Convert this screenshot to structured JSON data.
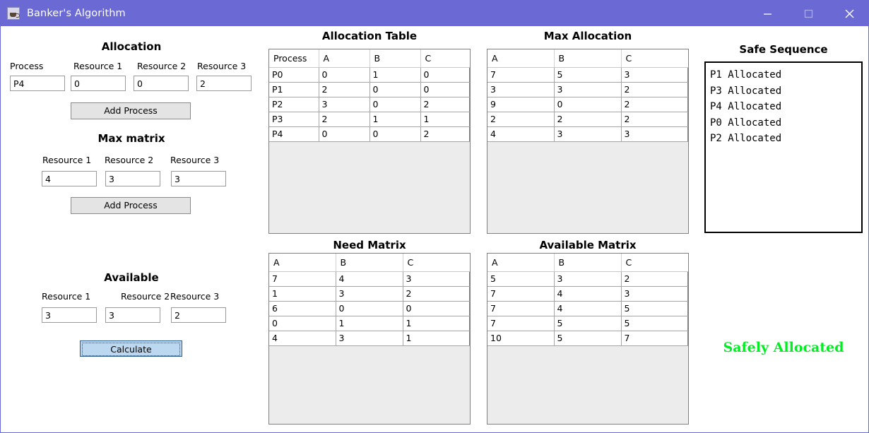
{
  "window": {
    "title": "Banker's Algorithm",
    "icon": "java-coffee-icon",
    "titlebar_color": "#6b6ad4",
    "controls": {
      "minimize": "minimize-icon",
      "maximize": "maximize-icon",
      "close": "close-icon"
    }
  },
  "allocation_form": {
    "heading": "Allocation",
    "labels": [
      "Process",
      "Resource 1",
      "Resource 2",
      "Resource 3"
    ],
    "values": [
      "P4",
      "0",
      "0",
      "2"
    ],
    "button": "Add Process"
  },
  "max_form": {
    "heading": "Max matrix",
    "labels": [
      "Resource 1",
      "Resource 2",
      "Resource 3"
    ],
    "values": [
      "4",
      "3",
      "3"
    ],
    "button": "Add Process"
  },
  "available_form": {
    "heading": "Available",
    "labels": [
      "Resource 1",
      "Resource 2",
      "Resource 3"
    ],
    "values": [
      "3",
      "3",
      "2"
    ],
    "button": "Calculate",
    "button_focused": true
  },
  "allocation_table": {
    "title": "Allocation Table",
    "columns": [
      "Process",
      "A",
      "B",
      "C"
    ],
    "rows": [
      [
        "P0",
        "0",
        "1",
        "0"
      ],
      [
        "P1",
        "2",
        "0",
        "0"
      ],
      [
        "P2",
        "3",
        "0",
        "2"
      ],
      [
        "P3",
        "2",
        "1",
        "1"
      ],
      [
        "P4",
        "0",
        "0",
        "2"
      ]
    ]
  },
  "max_table": {
    "title": "Max Allocation",
    "columns": [
      "A",
      "B",
      "C"
    ],
    "rows": [
      [
        "7",
        "5",
        "3"
      ],
      [
        "3",
        "3",
        "2"
      ],
      [
        "9",
        "0",
        "2"
      ],
      [
        "2",
        "2",
        "2"
      ],
      [
        "4",
        "3",
        "3"
      ]
    ]
  },
  "need_table": {
    "title": "Need Matrix",
    "columns": [
      "A",
      "B",
      "C"
    ],
    "rows": [
      [
        "7",
        "4",
        "3"
      ],
      [
        "1",
        "3",
        "2"
      ],
      [
        "6",
        "0",
        "0"
      ],
      [
        "0",
        "1",
        "1"
      ],
      [
        "4",
        "3",
        "1"
      ]
    ]
  },
  "available_table": {
    "title": "Available Matrix",
    "columns": [
      "A",
      "B",
      "C"
    ],
    "rows": [
      [
        "5",
        "3",
        "2"
      ],
      [
        "7",
        "4",
        "3"
      ],
      [
        "7",
        "4",
        "5"
      ],
      [
        "7",
        "5",
        "5"
      ],
      [
        "10",
        "5",
        "7"
      ]
    ]
  },
  "safe_sequence": {
    "title": "Safe Sequence",
    "lines": [
      "P1 Allocated",
      "P3 Allocated",
      "P4 Allocated",
      "P0 Allocated",
      "P2 Allocated"
    ]
  },
  "status": {
    "text": "Safely Allocated",
    "color": "#00ee22"
  }
}
